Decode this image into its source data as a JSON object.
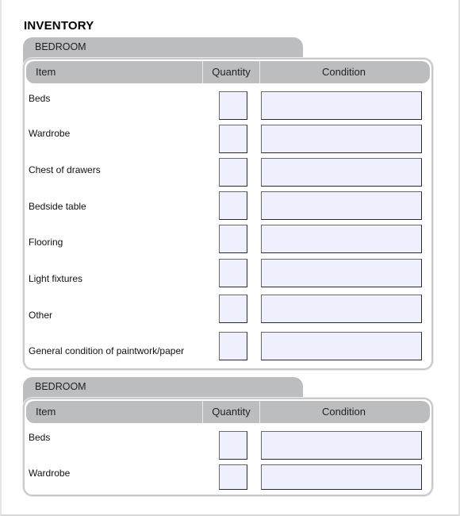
{
  "title": "INVENTORY",
  "columns": {
    "item": "Item",
    "quantity": "Quantity",
    "condition": "Condition"
  },
  "colors": {
    "header_gray": "#bcbdbf",
    "field_fill": "#eef1fd"
  },
  "sections": [
    {
      "name": "BEDROOM",
      "rows": [
        {
          "label": "Beds",
          "quantity": "",
          "condition": ""
        },
        {
          "label": "Wardrobe",
          "quantity": "",
          "condition": ""
        },
        {
          "label": "Chest of drawers",
          "quantity": "",
          "condition": ""
        },
        {
          "label": "Bedside table",
          "quantity": "",
          "condition": ""
        },
        {
          "label": "Flooring",
          "quantity": "",
          "condition": ""
        },
        {
          "label": "Light fixtures",
          "quantity": "",
          "condition": ""
        },
        {
          "label": "Other",
          "quantity": "",
          "condition": ""
        },
        {
          "label": "General condition of paintwork/paper",
          "quantity": "",
          "condition": ""
        }
      ]
    },
    {
      "name": "BEDROOM",
      "rows": [
        {
          "label": "Beds",
          "quantity": "",
          "condition": ""
        },
        {
          "label": "Wardrobe",
          "quantity": "",
          "condition": ""
        }
      ]
    }
  ]
}
